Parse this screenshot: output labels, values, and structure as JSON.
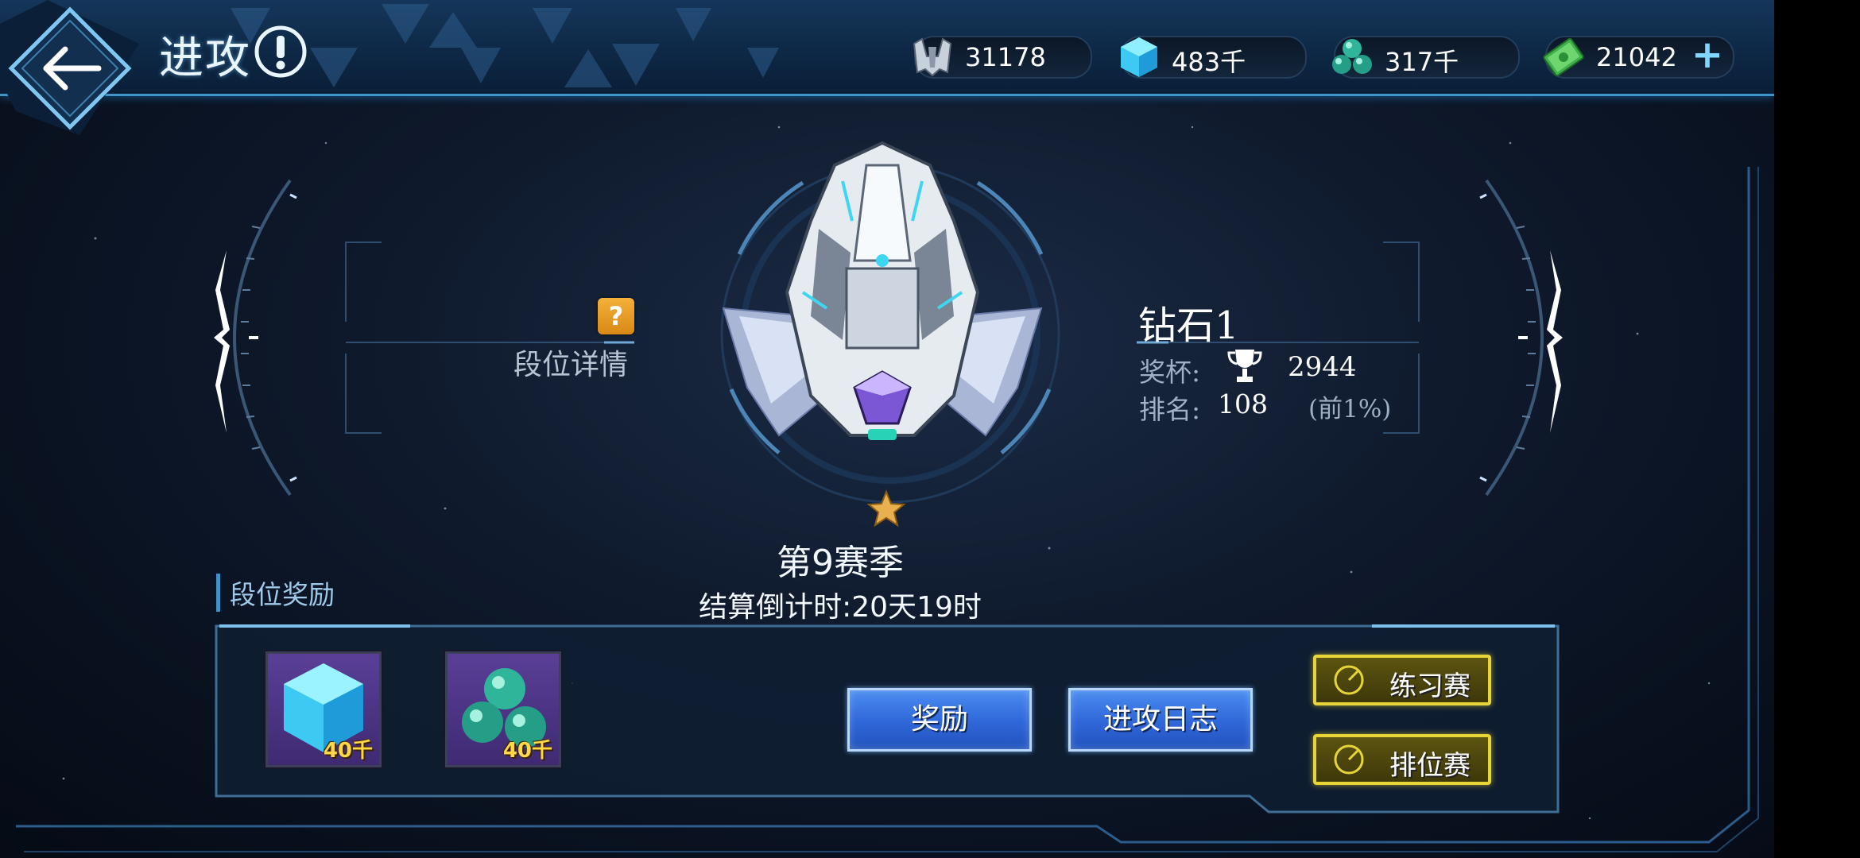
{
  "header": {
    "title": "进攻",
    "resources": [
      {
        "name": "ship-parts",
        "value": "31178"
      },
      {
        "name": "crystal",
        "value": "483千"
      },
      {
        "name": "orbs",
        "value": "317千"
      },
      {
        "name": "cash",
        "value": "21042"
      }
    ]
  },
  "rank_detail": {
    "badge": "?",
    "label": "段位详情"
  },
  "rank": {
    "name": "钻石1",
    "trophy_label": "奖杯:",
    "trophy_value": "2944",
    "position_label": "排名:",
    "position_value": "108",
    "position_percent": "(前1%)"
  },
  "season": {
    "title": "第9赛季",
    "countdown": "结算倒计时:20天19时"
  },
  "rewards": {
    "header": "段位奖励",
    "items": [
      {
        "icon": "crystal-icon",
        "qty": "40千"
      },
      {
        "icon": "orbs-icon",
        "qty": "40千"
      }
    ]
  },
  "buttons": {
    "reward": "奖励",
    "attack_log": "进攻日志",
    "practice": "练习赛",
    "ranked": "排位赛"
  },
  "colors": {
    "accent_blue": "#3e93c9",
    "button_blue": "#2f66d8",
    "gold": "#e7d538",
    "reward_qty": "#ffd84a"
  }
}
